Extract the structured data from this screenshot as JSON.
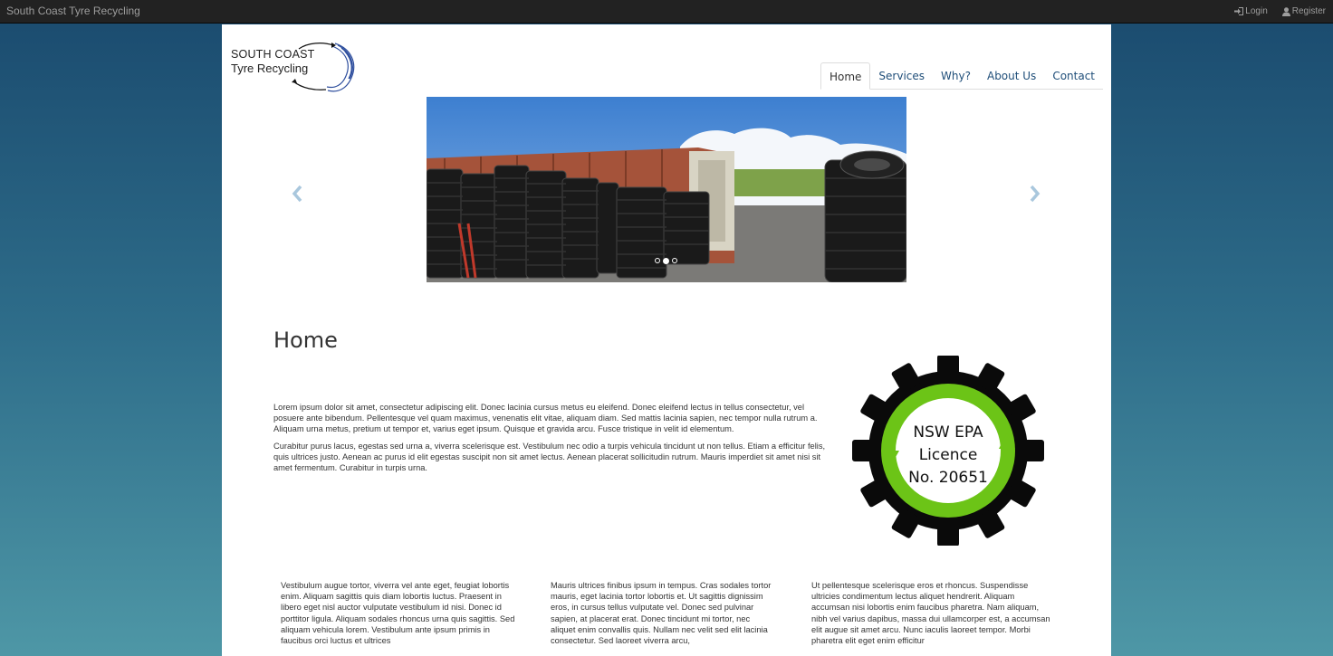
{
  "topbar": {
    "brand": "South Coast Tyre Recycling",
    "login": "Login",
    "register": "Register"
  },
  "logo": {
    "line1": "SOUTH COAST",
    "line2": "Tyre Recycling"
  },
  "nav": {
    "tabs": [
      {
        "label": "Home"
      },
      {
        "label": "Services"
      },
      {
        "label": "Why?"
      },
      {
        "label": "About Us"
      },
      {
        "label": "Contact"
      }
    ],
    "active": "Home"
  },
  "carousel": {
    "slides": 3,
    "active_slide": 2
  },
  "main": {
    "title": "Home",
    "intro_p1": "Lorem ipsum dolor sit amet, consectetur adipiscing elit. Donec lacinia cursus metus eu eleifend. Donec eleifend lectus in tellus consectetur, vel posuere ante bibendum. Pellentesque vel quam maximus, venenatis elit vitae, aliquam diam. Sed mattis lacinia sapien, nec tempor nulla rutrum a. Aliquam urna metus, pretium ut tempor et, varius eget ipsum. Quisque et gravida arcu. Fusce tristique in velit id elementum.",
    "intro_p2": "Curabitur purus lacus, egestas sed urna a, viverra scelerisque est. Vestibulum nec odio a turpis vehicula tincidunt ut non tellus. Etiam a efficitur felis, quis ultrices justo. Aenean ac purus id elit egestas suscipit non sit amet lectus. Aenean placerat sollicitudin rutrum. Mauris imperdiet sit amet nisi sit amet fermentum. Curabitur in turpis urna."
  },
  "badge": {
    "line1": "NSW EPA",
    "line2": "Licence",
    "line3": "No. 20651",
    "colors": {
      "gear": "#0a0a0a",
      "ring": "#6cc417"
    }
  },
  "columns": [
    "Vestibulum augue tortor, viverra vel ante eget, feugiat lobortis enim. Aliquam sagittis quis diam lobortis luctus. Praesent in libero eget nisl auctor vulputate vestibulum id nisi. Donec id porttitor ligula. Aliquam sodales rhoncus urna quis sagittis. Sed aliquam vehicula lorem. Vestibulum ante ipsum primis in faucibus orci luctus et ultrices",
    "Mauris ultrices finibus ipsum in tempus. Cras sodales tortor mauris, eget lacinia tortor lobortis et. Ut sagittis dignissim eros, in cursus tellus vulputate vel. Donec sed pulvinar sapien, at placerat erat. Donec tincidunt mi tortor, nec aliquet enim convallis quis. Nullam nec velit sed elit lacinia consectetur. Sed laoreet viverra arcu,",
    "Ut pellentesque scelerisque eros et rhoncus. Suspendisse ultricies condimentum lectus aliquet hendrerit. Aliquam accumsan nisi lobortis enim faucibus pharetra. Nam aliquam, nibh vel varius dapibus, massa dui ullamcorper est, a accumsan elit augue sit amet arcu. Nunc iaculis laoreet tempor. Morbi pharetra elit eget enim efficitur"
  ]
}
